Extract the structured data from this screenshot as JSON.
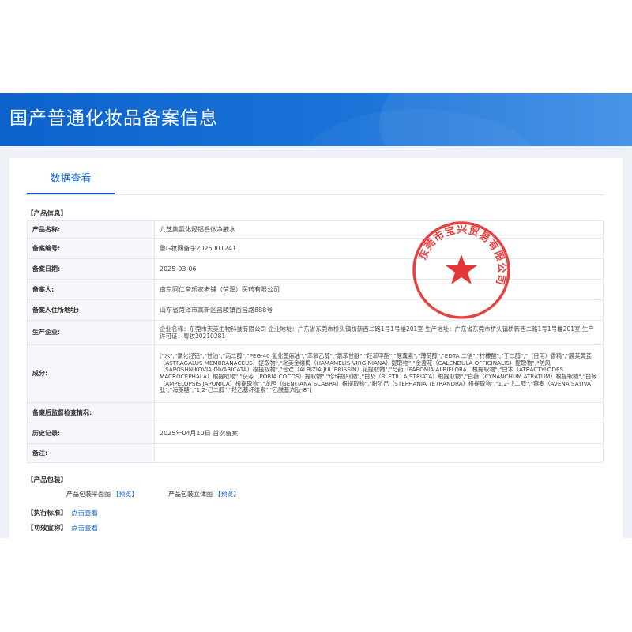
{
  "header": {
    "title": "国产普通化妆品备案信息"
  },
  "tab": {
    "label": "数据查看"
  },
  "sections": {
    "product_info": "【产品信息】",
    "packaging": "【产品包装】",
    "standard": "【执行标准】",
    "efficacy": "【功效宣称】"
  },
  "rows": [
    {
      "key": "产品名称:",
      "value": "九芝集氯化羟铝香体净腋水"
    },
    {
      "key": "备案编号:",
      "value": "鲁G妆网备字2025001241"
    },
    {
      "key": "备案日期:",
      "value": "2025-03-06"
    },
    {
      "key": "备案人:",
      "value": "南京同仁堂乐家老铺（菏泽）医药有限公司"
    },
    {
      "key": "备案人住所地址:",
      "value": "山东省菏泽市高新区昌陵镇西昌路888号"
    },
    {
      "key": "生产企业:",
      "value": "企业名称：东莞市天美生物科技有限公司 企业地址：广东省东莞市桥头镇桥新西二路1号1号楼201室 生产地址：广东省东莞市桥头镇桥新西二路1号1号楼201室 生产许可证：粤妆20210281"
    },
    {
      "key": "成分:",
      "value": "[\"水\",\"氯化羟铝\",\"甘油\",\"丙二醇\",\"PEG-40 氢化蓖麻油\",\"苯氧乙醇\",\"氯苯甘醚\",\"羟苯甲酯\",\"尿囊素\",\"薄荷醇\",\"EDTA 二钠\",\"柠檬酸\",\"丁二醇\",\"（日用）香精\",\"膜荚黄芪（ASTRAGALUS MEMBRANACEUS）提取物\",\"北美金缕梅（HAMAMELIS VIRGINIANA）提取物\",\"金盏花（CALENDULA OFFICINALIS）提取物\",\"防风（SAPOSHNIKOVIA DIVARICATA）根提取物\",\"合欢（ALBIZIA JULIBRISSIN）花提取物\",\"芍药（PAEONIA ALBIFLORA）根提取物\",\"白术（ATRACTYLODES MACROCEPHALA）根提取物\",\"茯苓（PORIA COCOS）提取物\",\"珍珠提取物\",\"白及（BLETILLA STRIATA）根提取物\",\"白薇（CYNANCHUM ATRATUM）根提取物\",\"白蔹（AMPELOPSIS JAPONICA）根提取物\",\"龙胆（GENTIANA SCABRA）根提取物\",\"粉防己（STEPHANIA TETRANDRA）根提取物\",\"1,2-戊二醇\",\"燕麦（AVENA SATIVA）肽\",\"海藻糖\",\"1,2-己二醇\",\"羟乙基纤维素\",\"乙酰基六肽-8\"]"
    },
    {
      "key": "备案后监督检查情况:",
      "value": ""
    },
    {
      "key": "历史记录:",
      "value": "2025年04月10日 首次备案"
    },
    {
      "key": "备注:",
      "value": ""
    }
  ],
  "packaging": {
    "flat_label": "产品包装平面图",
    "flat_link": "【预览】",
    "solid_label": "产品包装立体图",
    "solid_link": "【预览】"
  },
  "standard": {
    "link": "点击查看"
  },
  "efficacy": {
    "link": "点击查看"
  },
  "seal": {
    "text": "东莞市宝兴贸易有限公司",
    "color": "#e02020"
  }
}
